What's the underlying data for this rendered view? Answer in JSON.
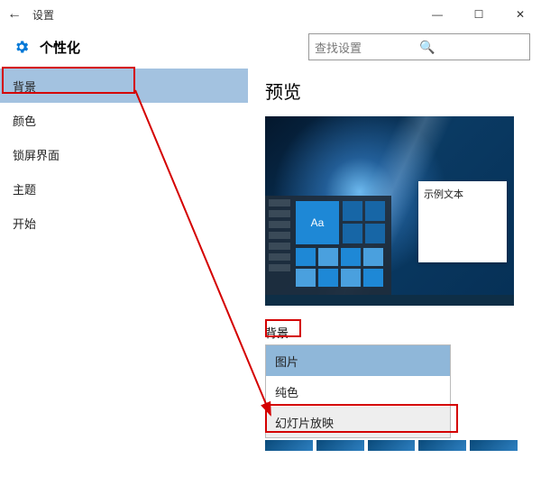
{
  "window": {
    "title": "设置",
    "min": "—",
    "max": "☐",
    "close": "✕",
    "back": "←"
  },
  "header": {
    "label": "个性化",
    "search_placeholder": "查找设置"
  },
  "sidebar": {
    "items": [
      {
        "label": "背景",
        "selected": true
      },
      {
        "label": "颜色",
        "selected": false
      },
      {
        "label": "锁屏界面",
        "selected": false
      },
      {
        "label": "主题",
        "selected": false
      },
      {
        "label": "开始",
        "selected": false
      }
    ]
  },
  "content": {
    "preview_heading": "预览",
    "sample_text": "示例文本",
    "tile_text": "Aa",
    "dropdown_label": "背景",
    "options": [
      {
        "label": "图片",
        "state": "sel"
      },
      {
        "label": "纯色",
        "state": ""
      },
      {
        "label": "幻灯片放映",
        "state": "highlight"
      }
    ]
  }
}
